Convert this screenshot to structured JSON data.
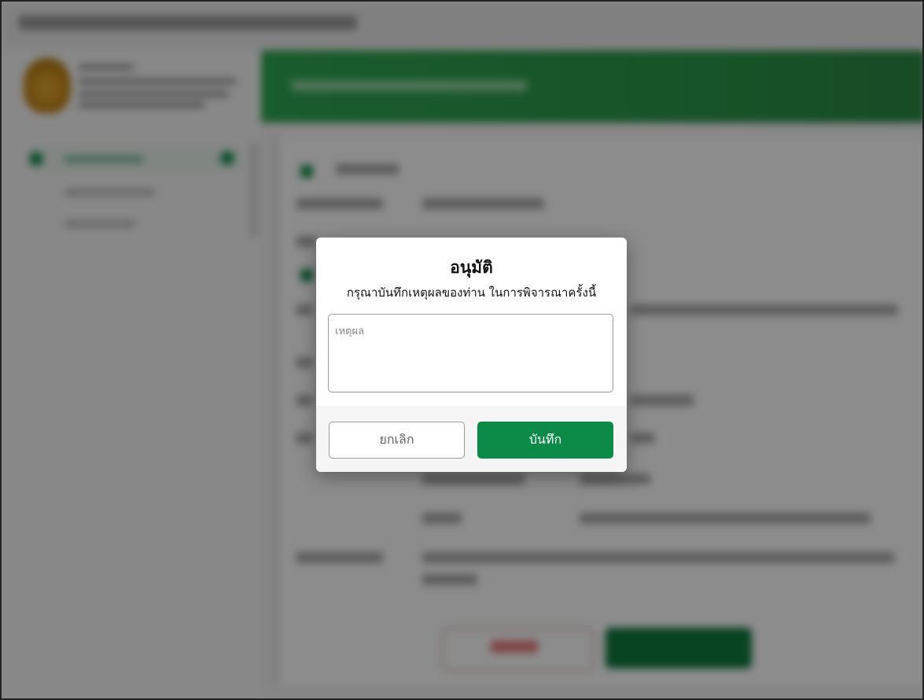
{
  "dialog": {
    "title": "อนุมัติ",
    "description": "กรุณาบันทึกเหตุผลของท่าน ในการพิจารณาครั้งนี้",
    "reason_input": {
      "placeholder": "เหตุผล",
      "value": ""
    },
    "cancel_label": "ยกเลิก",
    "save_label": "บันทึก"
  },
  "colors": {
    "primary_green": "#0b8a48",
    "header_green": "#2fa852",
    "overlay": "rgba(0,0,0,0.45)"
  }
}
